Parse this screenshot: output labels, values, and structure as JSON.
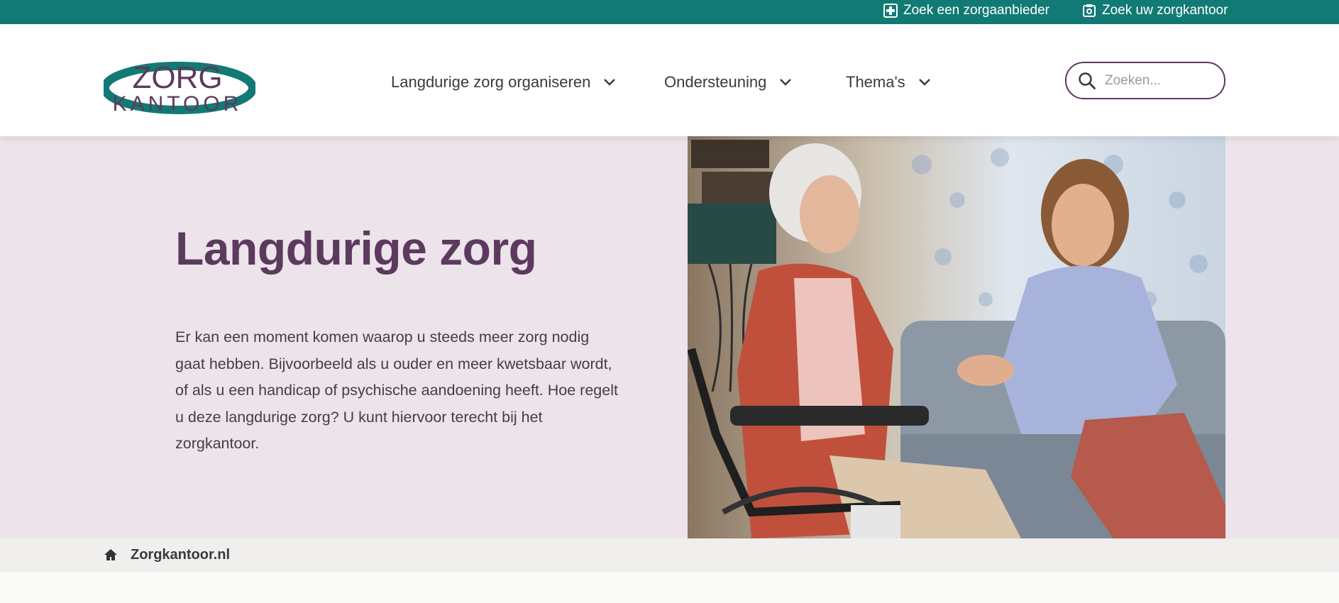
{
  "topbar": {
    "links": [
      {
        "label": "Zoek een zorgaanbieder",
        "icon": "medical-cross-icon"
      },
      {
        "label": "Zoek uw zorgkantoor",
        "icon": "building-icon"
      }
    ]
  },
  "header": {
    "logo_top": "ZORG",
    "logo_bottom": "KANTOOR",
    "nav": [
      {
        "label": "Langdurige zorg organiseren"
      },
      {
        "label": "Ondersteuning"
      },
      {
        "label": "Thema's"
      }
    ],
    "search": {
      "placeholder": "Zoeken..."
    }
  },
  "hero": {
    "title": "Langdurige zorg",
    "text": "Er kan een moment komen waarop u steeds meer zorg nodig gaat hebben. Bijvoorbeeld als u ouder en meer kwetsbaar wordt, of als u een handicap of psychische aandoening heeft. Hoe regelt u deze langdurige zorg? U kunt hiervoor terecht bij het zorgkantoor."
  },
  "breadcrumb": {
    "home_icon": "home-icon",
    "current": "Zorgkantoor.nl"
  },
  "colors": {
    "topbar": "#127a74",
    "brand_purple": "#5c3a5e",
    "hero_bg": "#ece4ea",
    "breadcrumb_bg": "#f1efed"
  }
}
